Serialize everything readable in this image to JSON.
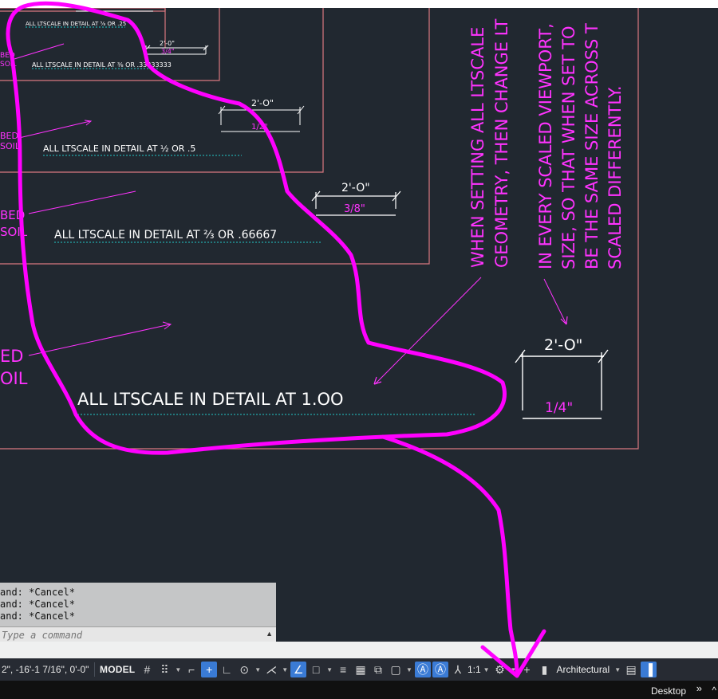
{
  "colors": {
    "canvas_bg": "#212830",
    "viewport_border": "#d9777f",
    "magenta": "#ff33ff",
    "cyan_line": "#23c9c9",
    "white_text": "#ffffff",
    "annotation_pen": "#ff00ff"
  },
  "drawing": {
    "details": [
      {
        "label": "ALL LTSCALE IN DETAIL AT ⅝ OR .25"
      },
      {
        "label": "ALL LTSCALE IN DETAIL AT ⅜ OR .33333333"
      },
      {
        "label": "ALL LTSCALE IN DETAIL AT ½ OR .5"
      },
      {
        "label": "ALL LTSCALE IN DETAIL AT ⅔ OR .66667"
      },
      {
        "label": "ALL LTSCALE IN DETAIL AT 1.OO"
      }
    ],
    "dims": [
      {
        "top": "2'-0\"",
        "bottom": "3/4\""
      },
      {
        "top": "2'-O\"",
        "bottom": "1/2\""
      },
      {
        "top": "2'-O\"",
        "bottom": "3/8\""
      },
      {
        "top": "2'-O\"",
        "bottom": "1/4\""
      }
    ],
    "left_labels": [
      {
        "l1": "BED",
        "l2": "SOIL"
      },
      {
        "l1": "BED",
        "l2": "SOIL"
      },
      {
        "l1": "BED",
        "l2": "SOIL"
      },
      {
        "l1": "ED",
        "l2": "OIL"
      }
    ],
    "note1": {
      "line1": "WHEN SETTING ALL LTSCALE",
      "line2": "GEOMETRY, THEN CHANGE LT"
    },
    "note2": {
      "line1": "IN EVERY SCALED VIEWPORT,",
      "line2": "SIZE, SO THAT WHEN SET TO",
      "line3": "BE THE SAME SIZE ACROSS T",
      "line4": "SCALED DIFFERENTLY."
    }
  },
  "command_window": {
    "history": [
      "and: *Cancel*",
      "and: *Cancel*",
      "and: *Cancel*"
    ],
    "placeholder": "Type a command"
  },
  "status_bar": {
    "coordinates": "2\", -16'-1 7/16\", 0'-0\"",
    "model_label": "MODEL",
    "scale_label": "1:1",
    "units_label": "Architectural",
    "icons": [
      "grid-icon",
      "snap-icon",
      "infer-icon",
      "snap-cursor-icon",
      "ortho-icon",
      "polar-icon",
      "isodraft-icon",
      "osnap-tracking-icon",
      "object-snap-icon",
      "lineweight-icon",
      "transparency-icon",
      "selection-cycling-icon",
      "3d-osnap-icon",
      "annotation-visibility-icon",
      "auto-scale-icon",
      "annotation-scale-icon",
      "workspace-gear-icon",
      "annotation-monitor-icon",
      "units-icon",
      "quick-properties-icon"
    ]
  },
  "taskbar": {
    "desktop_label": "Desktop"
  }
}
